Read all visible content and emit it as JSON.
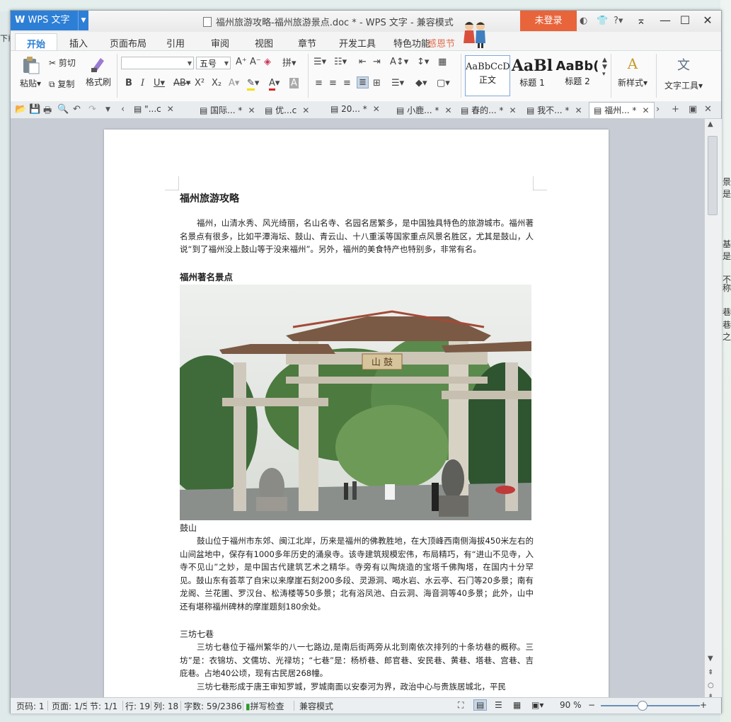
{
  "background": {
    "left_fragment": "下载",
    "right_fragments": [
      "景是",
      "基是",
      "不",
      "称",
      "巷",
      "巷之"
    ]
  },
  "titlebar": {
    "app_name": "WPS 文字",
    "title": "福州旅游攻略-福州旅游景点.doc * - WPS 文字 - 兼容模式",
    "login": "未登录",
    "help": "?"
  },
  "tabs": [
    "开始",
    "插入",
    "页面布局",
    "引用",
    "审阅",
    "视图",
    "章节",
    "开发工具",
    "特色功能"
  ],
  "promo_text": "感恩节",
  "ribbon": {
    "paste": "粘贴",
    "cut": "剪切",
    "copy": "复制",
    "format_painter": "格式刷",
    "font_name": "",
    "font_size": "五号",
    "styles": [
      {
        "sample": "AaBbCcD",
        "label": "正文"
      },
      {
        "sample": "AaBl",
        "label": "标题 1"
      },
      {
        "sample": "AaBb(",
        "label": "标题 2"
      }
    ],
    "new_style": "新样式",
    "text_tools": "文字工具"
  },
  "doc_tabs": [
    {
      "label": "\"...c"
    },
    {
      "label": "国际... *"
    },
    {
      "label": "优...c"
    },
    {
      "label": "20... *"
    },
    {
      "label": "小鹿... *"
    },
    {
      "label": "春的... *"
    },
    {
      "label": "我不... *"
    },
    {
      "label": "福州... *"
    }
  ],
  "document": {
    "title": "福州旅游攻略",
    "intro": "福州，山清水秀、风光绮丽，名山名寺、名园名居繁多，是中国独具特色的旅游城市。福州著名景点有很多，比如平潭海坛、鼓山、青云山、十八重溪等国家重点风景名胜区，尤其是鼓山，人说“到了福州没上鼓山等于没来福州”。另外，福州的美食特产也特别多，非常有名。",
    "section_heading": "福州著名景点",
    "gate_plaque": "山 鼓",
    "gushan_title": "鼓山",
    "gushan_text": "鼓山位于福州市东郊、闽江北岸，历来是福州的佛教胜地，在大顶峰西南侧海拔450米左右的山间盆地中，保存有1000多年历史的涌泉寺。该寺建筑规模宏伟，布局精巧，有“进山不见寺，入寺不见山”之妙，是中国古代建筑艺术之精华。寺旁有以陶烧造的宝塔千佛陶塔，在国内十分罕见。鼓山东有荟萃了自宋以来摩崖石刻200多段、灵源洞、喝水岩、水云亭、石门等20多景；南有龙阁、兰花圃、罗汉台、松涛楼等50多景；北有浴凤池、白云洞、海音洞等40多景；此外，山中还有堪称福州碑林的摩崖题刻180余处。",
    "sfqx_title": "三坊七巷",
    "sfqx_text1": "三坊七巷位于福州繁华的八一七路边,是南后街两旁从北到南依次排列的十条坊巷的概称。三坊”是：衣锦坊、文儒坊、光禄坊；“七巷”是：杨桥巷、郎官巷、安民巷、黄巷、塔巷、宫巷、吉庇巷。占地40公顷，现有古民居268幢。",
    "sfqx_text2": "三坊七巷形成于唐王审知罗城，罗城南面以安泰河为界，政治中心与贵族居城北，平民"
  },
  "status": {
    "page_code": "页码: 1",
    "page": "页面: 1/5",
    "section": "节: 1/1",
    "row": "行: 19",
    "col": "列: 18",
    "words": "字数: 59/2386",
    "spell": "拼写检查",
    "compat": "兼容模式",
    "zoom": "90 %"
  }
}
